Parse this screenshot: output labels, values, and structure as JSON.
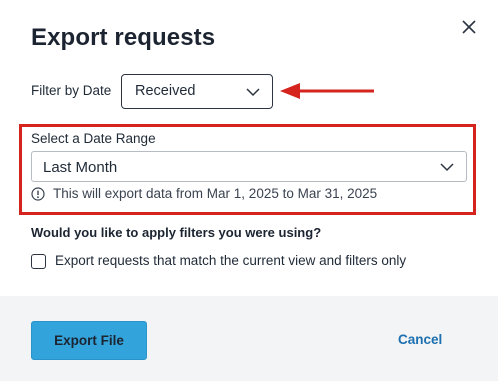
{
  "dialog": {
    "title": "Export requests",
    "close_icon": "close-icon"
  },
  "filter_by_date": {
    "label": "Filter by Date",
    "selected": "Received"
  },
  "date_range": {
    "label": "Select a Date Range",
    "selected": "Last Month",
    "info": "This will export data from Mar 1, 2025 to Mar 31, 2025"
  },
  "filters": {
    "question": "Would you like to apply filters you were using?",
    "checkbox_label": "Export requests that match the current view and filters only",
    "checked": false
  },
  "footer": {
    "export_label": "Export File",
    "cancel_label": "Cancel"
  },
  "colors": {
    "annotation_red": "#d5241d",
    "primary_button": "#33a3dc",
    "link_blue": "#1c6fb0"
  }
}
